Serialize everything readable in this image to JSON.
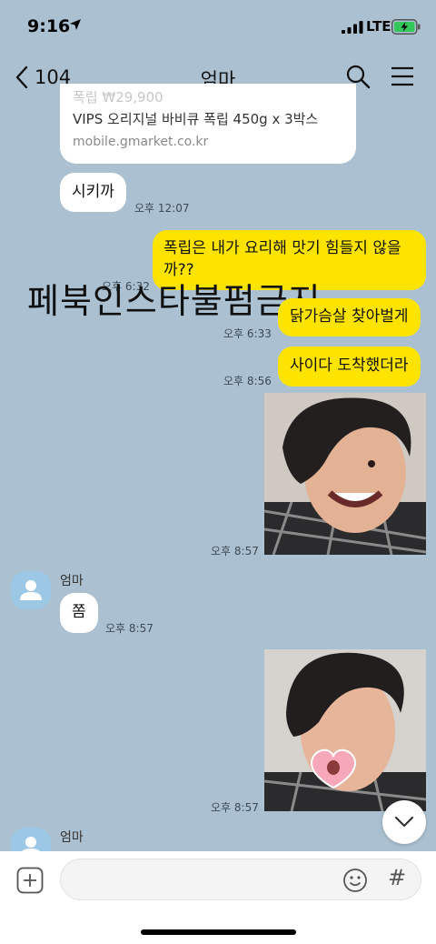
{
  "status_bar": {
    "time": "9:16",
    "network": "LTE"
  },
  "header": {
    "back_count": "104",
    "title": "엄마"
  },
  "link_card": {
    "price": "폭립 ₩29,900",
    "title": "VIPS 오리지널 바비큐 폭립 450g x 3박스",
    "url": "mobile.gmarket.co.kr"
  },
  "messages": [
    {
      "from": "mom",
      "text": "시키까",
      "time": "오후 12:07"
    },
    {
      "from": "me",
      "text": "폭립은 내가 요리해 맛기 힘들지 않을까??",
      "time": "오후 6:32"
    },
    {
      "from": "me",
      "text": "닭가슴살 찾아벌게",
      "time": "오후 6:33"
    },
    {
      "from": "me",
      "text": "사이다 도착했더라",
      "time": "오후 8:56"
    },
    {
      "from": "me",
      "type": "photo",
      "time": "오후 8:57"
    },
    {
      "from": "mom",
      "sender": "엄마",
      "text": "쫌",
      "time": "오후 8:57"
    },
    {
      "from": "me",
      "type": "photo",
      "time": "오후 8:57"
    },
    {
      "from": "mom",
      "sender": "엄마"
    }
  ],
  "watermark": "페북인스타불펌금지",
  "composer": {
    "placeholder": "",
    "hash_label": "#"
  },
  "colors": {
    "background": "#abc1d1",
    "outgoing_bubble": "#fde300",
    "incoming_bubble": "#ffffff"
  }
}
